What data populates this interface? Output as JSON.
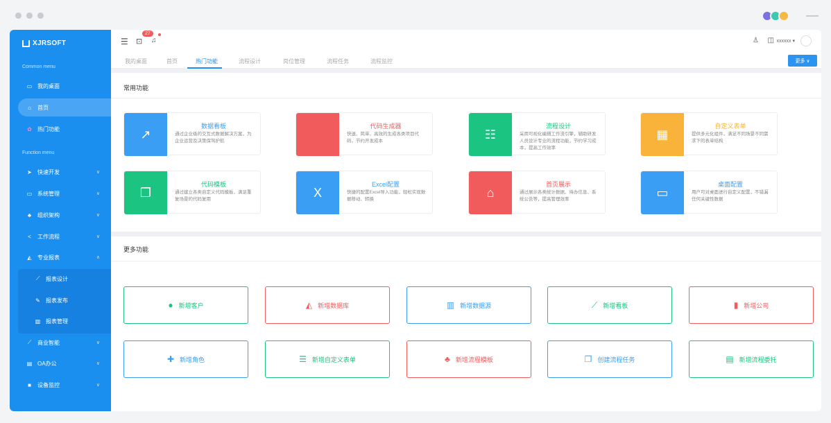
{
  "colors": {
    "primary": "#1b8ff0",
    "blue": "#3a9ef4",
    "red": "#f25b5b",
    "green": "#1bc481",
    "orange": "#f9b33b"
  },
  "sidebar": {
    "logo": "XJRSOFT",
    "common_menu_label": "Common menu",
    "function_menu_label": "Function menu",
    "common": [
      {
        "label": "我的桌面",
        "icon": "monitor-icon"
      },
      {
        "label": "首页",
        "icon": "home-icon"
      },
      {
        "label": "热门功能",
        "icon": "gear-icon"
      }
    ],
    "functions": [
      {
        "label": "快速开发",
        "icon": "send-icon"
      },
      {
        "label": "系统管理",
        "icon": "monitor-icon"
      },
      {
        "label": "组织架构",
        "icon": "org-icon"
      },
      {
        "label": "工作流程",
        "icon": "share-icon"
      },
      {
        "label": "专业报表",
        "icon": "area-chart-icon"
      },
      {
        "label": "报表设计",
        "icon": "line-chart-icon"
      },
      {
        "label": "报表发布",
        "icon": "pen-icon"
      },
      {
        "label": "报表管理",
        "icon": "bar-chart-icon"
      },
      {
        "label": "商业智能",
        "icon": "line-chart-icon"
      },
      {
        "label": "OA办公",
        "icon": "doc-icon"
      },
      {
        "label": "设备监控",
        "icon": "camera-icon"
      }
    ]
  },
  "topbar": {
    "badge_count": "27",
    "user": "xxxxxx"
  },
  "tabs": [
    "我的桌面",
    "首页",
    "热门功能",
    "流程设计",
    "岗位管理",
    "流程任务",
    "流程监控"
  ],
  "more_button": "更多",
  "common_section": {
    "title": "常用功能",
    "cards": [
      {
        "title": "数据看板",
        "desc": "通过企业级的交互式数据解决方案，为企业运营及决策保驾护航",
        "icon": "trend-icon",
        "color": "#3a9ef4",
        "title_color": "#3a9ef4"
      },
      {
        "title": "代码生成器",
        "desc": "快速、简单、高效的生成各类项目代码，节约开发成本",
        "icon": "code-icon",
        "color": "#f25b5b",
        "title_color": "#f25b5b"
      },
      {
        "title": "流程设计",
        "desc": "采用可视化编辑工作流引擎，辅助研发人员设计专业的流程功能，节约学习成本，提高工作效率",
        "icon": "sliders-icon",
        "color": "#1bc481",
        "title_color": "#1bc481"
      },
      {
        "title": "自定义表单",
        "desc": "提供多元化组件，满足不同场景不同需求下的表单结构",
        "icon": "form-icon",
        "color": "#f9b33b",
        "title_color": "#f9b33b"
      },
      {
        "title": "代码模板",
        "desc": "通过建立各类自定义代码模板，满足重复场景的代码复用",
        "icon": "copy-icon",
        "color": "#1bc481",
        "title_color": "#1bc481"
      },
      {
        "title": "Excel配置",
        "desc": "快捷的配置Excel导入功能，轻松实现数据移动、转换",
        "icon": "excel-icon",
        "color": "#3a9ef4",
        "title_color": "#3a9ef4"
      },
      {
        "title": "首页展示",
        "desc": "通过展示各类统计数据、待办信息、系统公告等，提高管理效率",
        "icon": "house-icon",
        "color": "#f25b5b",
        "title_color": "#f25b5b"
      },
      {
        "title": "桌面配置",
        "desc": "用户可对桌面进行自定义配置，不错漏任何关键性数据",
        "icon": "monitor-icon",
        "color": "#3a9ef4",
        "title_color": "#3a9ef4"
      }
    ]
  },
  "more_section": {
    "title": "更多功能",
    "buttons": [
      {
        "label": "新增客户",
        "icon": "user-icon",
        "color": "#1bc481"
      },
      {
        "label": "新增数据库",
        "icon": "area-chart-icon",
        "color": "#f25b5b"
      },
      {
        "label": "新增数据源",
        "icon": "bar-chart-icon",
        "color": "#3a9ef4"
      },
      {
        "label": "新增看板",
        "icon": "line-chart-icon",
        "color": "#1bc481"
      },
      {
        "label": "新增公司",
        "icon": "building-icon",
        "color": "#f25b5b"
      },
      {
        "label": "新增角色",
        "icon": "user-plus-icon",
        "color": "#3a9ef4"
      },
      {
        "label": "新增自定义表单",
        "icon": "list-icon",
        "color": "#1bc481"
      },
      {
        "label": "新增流程模板",
        "icon": "sitemap-icon",
        "color": "#f25b5b"
      },
      {
        "label": "创建流程任务",
        "icon": "files-icon",
        "color": "#3a9ef4"
      },
      {
        "label": "新增流程委托",
        "icon": "file-icon",
        "color": "#1bc481"
      }
    ]
  }
}
